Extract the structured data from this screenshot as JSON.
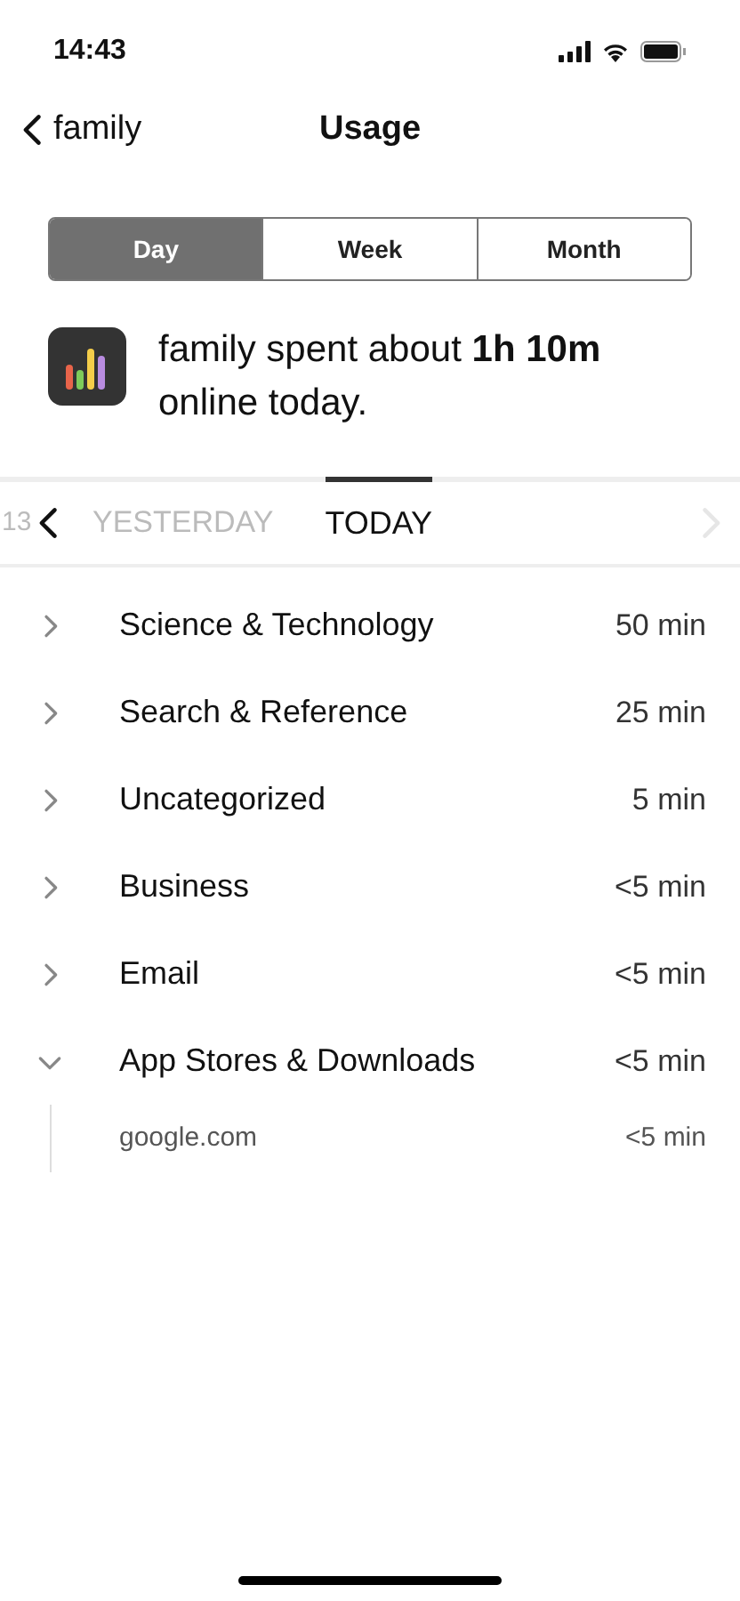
{
  "status_bar": {
    "time": "14:43"
  },
  "nav": {
    "back_label": "family",
    "title": "Usage"
  },
  "periods": [
    {
      "label": "Day",
      "selected": true
    },
    {
      "label": "Week",
      "selected": false
    },
    {
      "label": "Month",
      "selected": false
    }
  ],
  "summary": {
    "text": "family spent about **1h 10m** online today."
  },
  "days": {
    "previous_cut": "13",
    "prev_enabled": true,
    "next_enabled": false,
    "items": [
      {
        "label": "YESTERDAY",
        "selected": false
      },
      {
        "label": "TODAY",
        "selected": true
      }
    ]
  },
  "categories": [
    {
      "name": "Science & Technology",
      "time": "50 min",
      "expanded": false
    },
    {
      "name": "Search & Reference",
      "time": "25 min",
      "expanded": false
    },
    {
      "name": "Uncategorized",
      "time": "5 min",
      "expanded": false
    },
    {
      "name": "Business",
      "time": "<5 min",
      "expanded": false
    },
    {
      "name": "Email",
      "time": "<5 min",
      "expanded": false
    },
    {
      "name": "App Stores & Downloads",
      "time": "<5 min",
      "expanded": true,
      "children": [
        {
          "name": "google.com",
          "time": "<5 min"
        }
      ]
    }
  ]
}
